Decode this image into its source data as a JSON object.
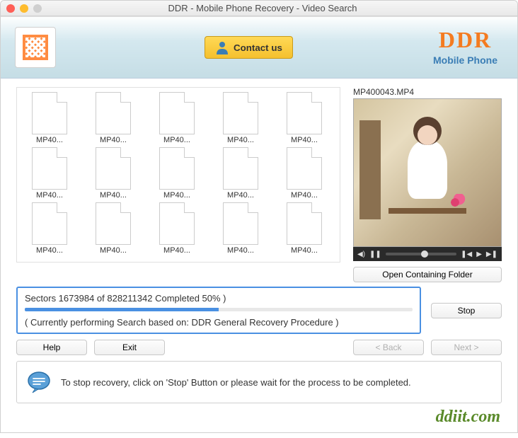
{
  "window": {
    "title": "DDR - Mobile Phone Recovery - Video Search"
  },
  "header": {
    "contact_label": "Contact us",
    "brand_main": "DDR",
    "brand_sub": "Mobile Phone"
  },
  "files": [
    {
      "label": "MP40..."
    },
    {
      "label": "MP40..."
    },
    {
      "label": "MP40..."
    },
    {
      "label": "MP40..."
    },
    {
      "label": "MP40..."
    },
    {
      "label": "MP40..."
    },
    {
      "label": "MP40..."
    },
    {
      "label": "MP40..."
    },
    {
      "label": "MP40..."
    },
    {
      "label": "MP40..."
    },
    {
      "label": "MP40..."
    },
    {
      "label": "MP40..."
    },
    {
      "label": "MP40..."
    },
    {
      "label": "MP40..."
    },
    {
      "label": "MP40..."
    }
  ],
  "preview": {
    "filename": "MP400043.MP4"
  },
  "buttons": {
    "open_folder": "Open Containing Folder",
    "stop": "Stop",
    "help": "Help",
    "exit": "Exit",
    "back": "< Back",
    "next": "Next >"
  },
  "progress": {
    "status": "Sectors 1673984 of  828211342  Completed 50% )",
    "percent": 50,
    "subtitle": "( Currently performing Search based on: DDR General Recovery Procedure )"
  },
  "hint": {
    "text": "To stop recovery, click on 'Stop' Button or please wait for the process to be completed."
  },
  "watermark": "ddiit.com"
}
